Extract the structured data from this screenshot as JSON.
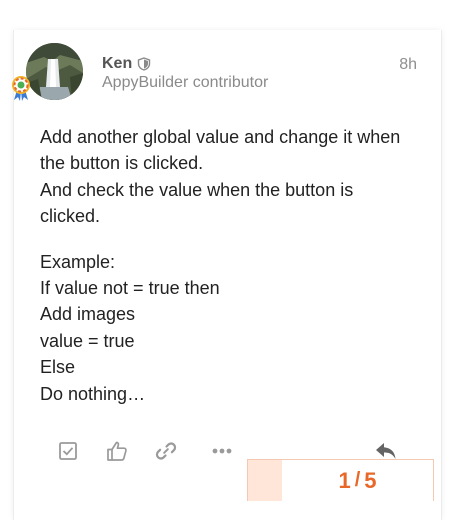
{
  "post": {
    "username": "Ken",
    "user_title": "AppyBuilder contributor",
    "timestamp": "8h",
    "body": {
      "paragraph1": [
        "Add another global value and change it when",
        "the button is clicked.",
        "And check the value when the button is",
        "clicked."
      ],
      "paragraph2": [
        "Example:",
        "If value not = true then",
        "Add images",
        "value = true",
        "Else",
        "Do nothing…"
      ]
    },
    "actions": [
      {
        "name": "solution-checkbox-icon"
      },
      {
        "name": "like-icon"
      },
      {
        "name": "link-icon"
      },
      {
        "name": "more-icon"
      },
      {
        "name": "reply-icon"
      }
    ]
  },
  "progress": {
    "current": "1",
    "separator": "/",
    "total": "5"
  },
  "colors": {
    "accent": "#e8682a",
    "progress_bg": "#ffe6d9",
    "text": "#222222",
    "muted": "#8a8a8a",
    "icon": "#9a9a9a"
  }
}
